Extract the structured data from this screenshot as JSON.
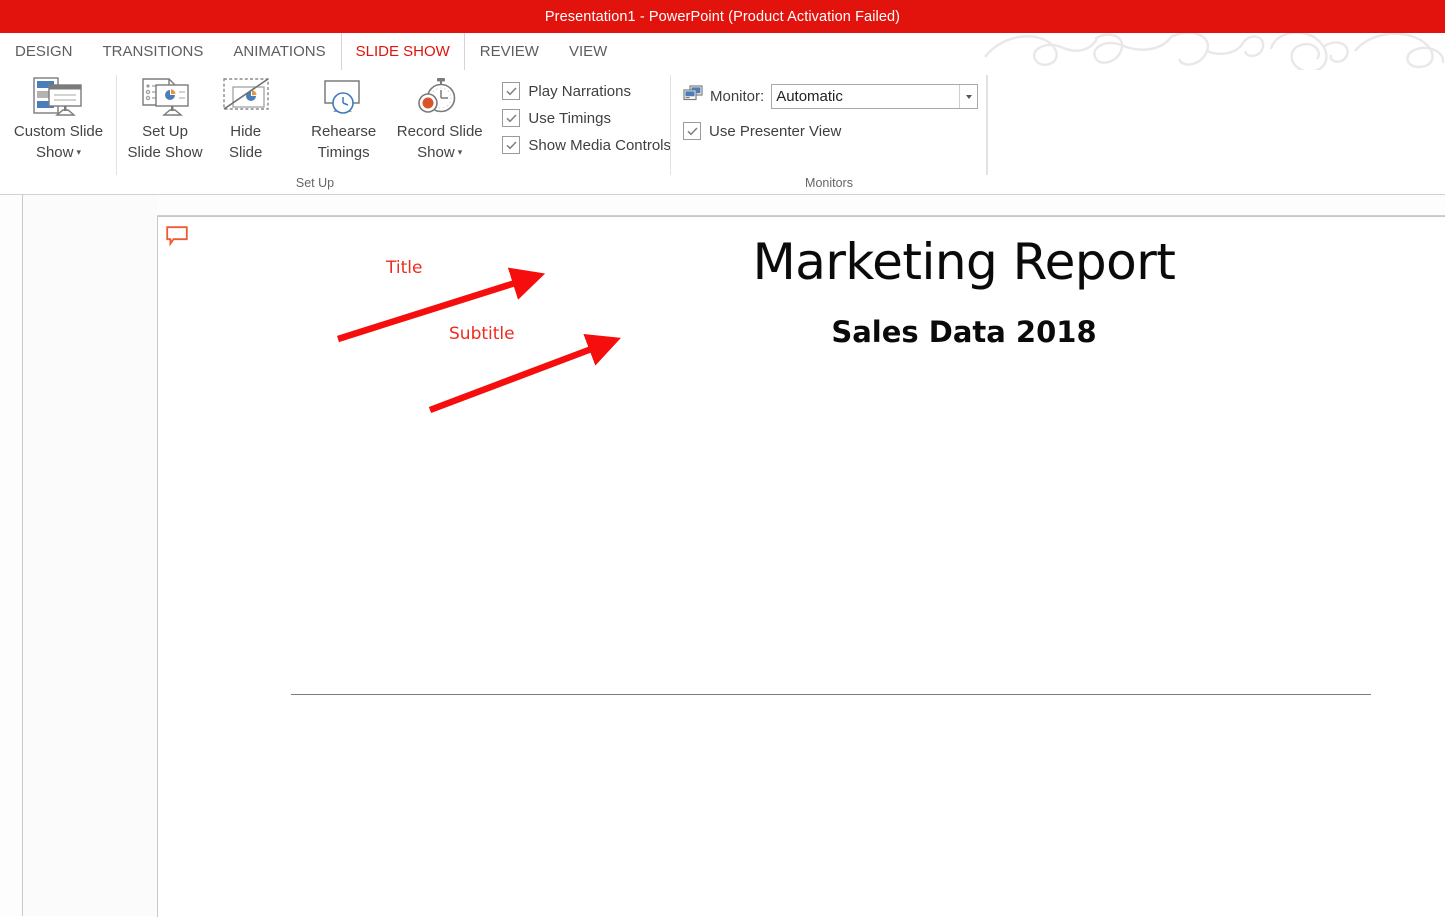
{
  "window": {
    "title": "Presentation1 -  PowerPoint (Product Activation Failed)",
    "titlebar_color": "#e1130c"
  },
  "tabs": [
    {
      "label": "DESIGN",
      "active": false
    },
    {
      "label": "TRANSITIONS",
      "active": false
    },
    {
      "label": "ANIMATIONS",
      "active": false
    },
    {
      "label": "SLIDE SHOW",
      "active": true
    },
    {
      "label": "REVIEW",
      "active": false
    },
    {
      "label": "VIEW",
      "active": false
    }
  ],
  "ribbon": {
    "groups": [
      {
        "name": "start-slide-show",
        "label": "",
        "buttons": [
          {
            "label": "Custom Slide\nShow",
            "icon": "custom-slide-show-icon",
            "has_caret": true
          },
          {
            "label": "Set Up\nSlide Show",
            "icon": "set-up-slide-show-icon",
            "has_caret": false
          },
          {
            "label": "Hide\nSlide",
            "icon": "hide-slide-icon",
            "has_caret": false
          }
        ]
      },
      {
        "name": "set-up",
        "label": "Set Up",
        "buttons": [
          {
            "label": "Rehearse\nTimings",
            "icon": "rehearse-timings-icon",
            "has_caret": false
          },
          {
            "label": "Record Slide\nShow",
            "icon": "record-slide-show-icon",
            "has_caret": true
          }
        ],
        "checkboxes": [
          {
            "label": "Play Narrations",
            "checked": true
          },
          {
            "label": "Use Timings",
            "checked": true
          },
          {
            "label": "Show Media Controls",
            "checked": true
          }
        ]
      },
      {
        "name": "monitors",
        "label": "Monitors",
        "monitor_label": "Monitor:",
        "monitor_value": "Automatic",
        "monitor_options": [
          "Automatic"
        ],
        "presenter_checkbox": {
          "label": "Use Presenter View",
          "checked": true
        }
      }
    ]
  },
  "slide": {
    "title": "Marketing Report",
    "subtitle": "Sales Data 2018",
    "comment_icon": "comment-bubble-icon",
    "annotations": [
      {
        "label": "Title",
        "target": "slide-title",
        "color": "#ee2b1f"
      },
      {
        "label": "Subtitle",
        "target": "slide-subtitle",
        "color": "#ee2b1f"
      }
    ]
  }
}
